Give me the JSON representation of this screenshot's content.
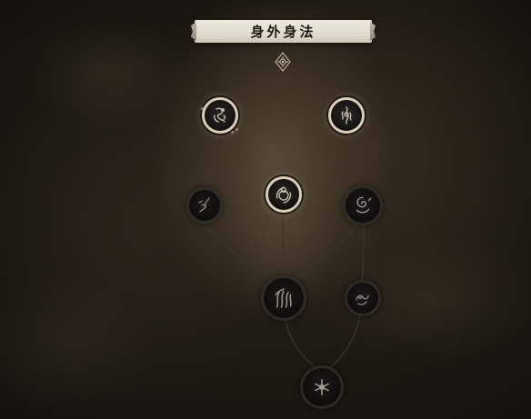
{
  "panel": {
    "title": "身外身法"
  },
  "icons": {
    "ornament": "diamond-flower-ornament-icon",
    "nodes": [
      "swirling-monkey-icon",
      "flaming-figure-icon",
      "spinning-gourd-icon",
      "twisted-vine-icon",
      "hair-clone-icon",
      "wind-swirl-icon",
      "cloud-serpent-icon",
      "scattered-stars-icon"
    ]
  },
  "colors": {
    "banner": "#e8e2d5",
    "unlocked_ring": "#d8cdb6",
    "locked_ring": "#2e2b27",
    "link_line": "#3a332a"
  }
}
